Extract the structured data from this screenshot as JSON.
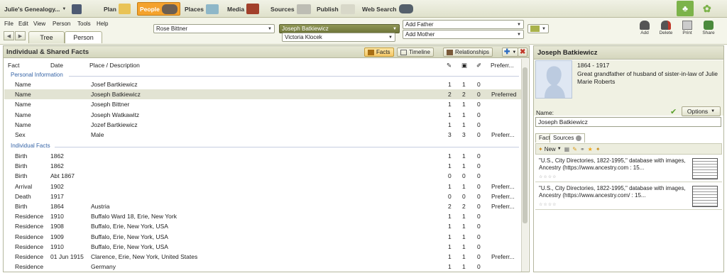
{
  "topbar": {
    "tree_name": "Julie's Genealogy...",
    "nav": [
      "Plan",
      "People",
      "Places",
      "Media",
      "Sources",
      "Publish",
      "Web Search"
    ]
  },
  "menus": [
    "File",
    "Edit",
    "View",
    "Person",
    "Tools",
    "Help"
  ],
  "view_tabs": [
    "Tree",
    "Person"
  ],
  "family": {
    "spouse_left": "Rose Bittner",
    "current_person": "Joseph Batkiewicz",
    "spouse_below": "Victoria Klocek",
    "add_father": "Add Father",
    "add_mother": "Add Mother"
  },
  "toolbar_right": [
    "Add",
    "Delete",
    "Print",
    "Share"
  ],
  "facts_panel": {
    "title": "Individual & Shared Facts",
    "buttons": [
      "Facts",
      "Timeline",
      "Relationships"
    ],
    "columns": [
      "Fact",
      "Date",
      "Place / Description",
      "Preferr..."
    ],
    "groups": [
      "Personal Information",
      "Individual Facts"
    ],
    "personal": [
      {
        "fact": "Name",
        "date": "",
        "place": "Josef Bartkiewicz",
        "a": "1",
        "b": "1",
        "c": "0",
        "pref": ""
      },
      {
        "fact": "Name",
        "date": "",
        "place": "Joseph Batkiewicz",
        "a": "2",
        "b": "2",
        "c": "0",
        "pref": "Preferred"
      },
      {
        "fact": "Name",
        "date": "",
        "place": "Joseph Bittner",
        "a": "1",
        "b": "1",
        "c": "0",
        "pref": ""
      },
      {
        "fact": "Name",
        "date": "",
        "place": "Joseph Watkawitz",
        "a": "1",
        "b": "1",
        "c": "0",
        "pref": ""
      },
      {
        "fact": "Name",
        "date": "",
        "place": "Jozef Bartkiewicz",
        "a": "1",
        "b": "1",
        "c": "0",
        "pref": ""
      },
      {
        "fact": "Sex",
        "date": "",
        "place": "Male",
        "a": "3",
        "b": "3",
        "c": "0",
        "pref": "Preferr..."
      }
    ],
    "individual": [
      {
        "fact": "Birth",
        "date": "1862",
        "place": "",
        "a": "1",
        "b": "1",
        "c": "0",
        "pref": ""
      },
      {
        "fact": "Birth",
        "date": "1862",
        "place": "",
        "a": "1",
        "b": "1",
        "c": "0",
        "pref": ""
      },
      {
        "fact": "Birth",
        "date": "Abt 1867",
        "place": "",
        "a": "0",
        "b": "0",
        "c": "0",
        "pref": ""
      },
      {
        "fact": "Arrival",
        "date": "1902",
        "place": "",
        "a": "1",
        "b": "1",
        "c": "0",
        "pref": "Preferr..."
      },
      {
        "fact": "Death",
        "date": "1917",
        "place": "",
        "a": "0",
        "b": "0",
        "c": "0",
        "pref": "Preferr..."
      },
      {
        "fact": "Birth",
        "date": "1864",
        "place": "Austria",
        "a": "2",
        "b": "2",
        "c": "0",
        "pref": "Preferr..."
      },
      {
        "fact": "Residence",
        "date": "1910",
        "place": "Buffalo Ward 18, Erie, New York",
        "a": "1",
        "b": "1",
        "c": "0",
        "pref": ""
      },
      {
        "fact": "Residence",
        "date": "1908",
        "place": "Buffalo, Erie, New York, USA",
        "a": "1",
        "b": "1",
        "c": "0",
        "pref": ""
      },
      {
        "fact": "Residence",
        "date": "1909",
        "place": "Buffalo, Erie, New York, USA",
        "a": "1",
        "b": "1",
        "c": "0",
        "pref": ""
      },
      {
        "fact": "Residence",
        "date": "1910",
        "place": "Buffalo, Erie, New York, USA",
        "a": "1",
        "b": "1",
        "c": "0",
        "pref": ""
      },
      {
        "fact": "Residence",
        "date": "01 Jun 1915",
        "place": "Clarence, Erie, New York, United States",
        "a": "1",
        "b": "1",
        "c": "0",
        "pref": "Preferr..."
      },
      {
        "fact": "Residence",
        "date": "",
        "place": "Germany",
        "a": "1",
        "b": "1",
        "c": "0",
        "pref": ""
      }
    ]
  },
  "person_panel": {
    "name": "Joseph Batkiewicz",
    "lifespan": "1864 - 1917",
    "relationship": "Great grandfather of husband of sister-in-law of Julie Marie Roberts",
    "name_label": "Name:",
    "options": "Options",
    "name_value": "Joseph Batkiewicz",
    "tabs": [
      "Fact",
      "Sources"
    ],
    "new_label": "New",
    "sources": [
      "\"U.S., City Directories, 1822-1995,\" database with images, Ancestry (https://www.ancestry.com : 15...",
      "\"U.S., City Directories, 1822-1995,\" database with images, Ancestry (https://www.ancestry.com/ : 15..."
    ]
  }
}
